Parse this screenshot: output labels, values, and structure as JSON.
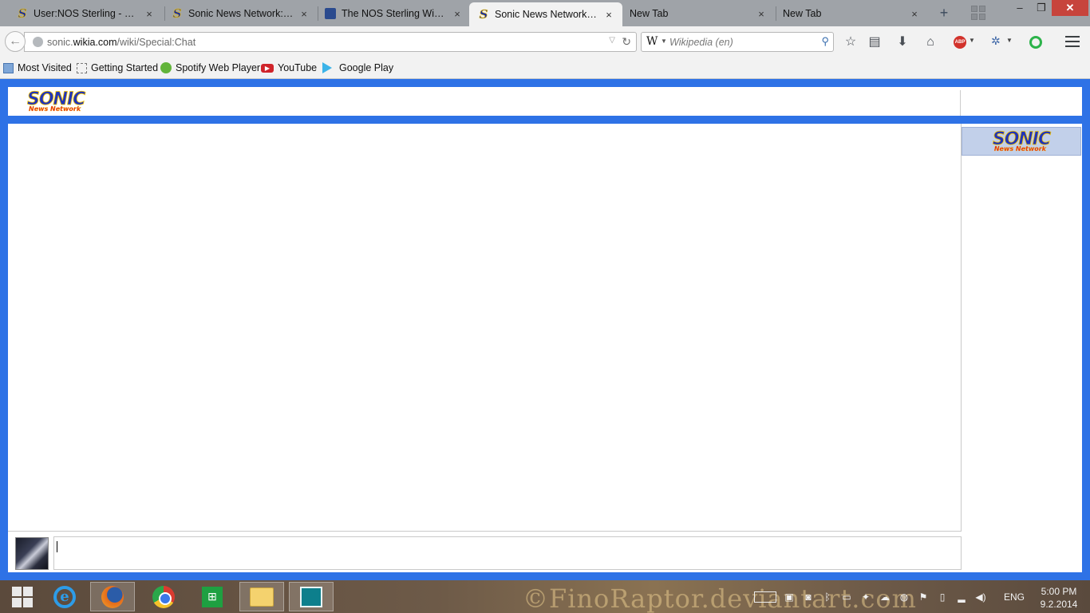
{
  "browser": {
    "tabs": [
      {
        "title": "User:NOS Sterling - Son...",
        "favicon": "sonic-s-icon",
        "active": false
      },
      {
        "title": "Sonic News Network:Al...",
        "favicon": "sonic-s-icon",
        "active": false
      },
      {
        "title": "The NOS Sterling Wiki: ...",
        "favicon": "wikia-icon",
        "active": false
      },
      {
        "title": "Sonic News Network: ...",
        "favicon": "sonic-s-icon",
        "active": true
      },
      {
        "title": "New Tab",
        "favicon": "",
        "active": false
      },
      {
        "title": "New Tab",
        "favicon": "",
        "active": false
      }
    ],
    "close_glyph": "×",
    "new_tab_glyph": "+",
    "window_controls": {
      "minimize": "–",
      "restore": "❐",
      "close": "✕"
    },
    "url": {
      "domain_pre": "sonic.",
      "domain_main": "wikia.com",
      "path": "/wiki/Special:Chat"
    },
    "search": {
      "engine_glyph": "W",
      "placeholder": "Wikipedia (en)"
    },
    "bookmarks": [
      {
        "label": "Most Visited",
        "icon": "most-visited-icon"
      },
      {
        "label": "Getting Started",
        "icon": "getting-started-icon"
      },
      {
        "label": "Spotify Web Player",
        "icon": "spotify-icon"
      },
      {
        "label": "YouTube",
        "icon": "youtube-icon"
      },
      {
        "label": "Google Play",
        "icon": "google-play-icon"
      }
    ],
    "addons": {
      "abp_label": "ABP"
    }
  },
  "chat": {
    "logo": {
      "line1": "SONIC",
      "line2": "News Network"
    },
    "sidebar_room_logo": {
      "line1": "SONIC",
      "line2": "News Network"
    },
    "message_input_value": ""
  },
  "taskbar": {
    "apps": [
      "start",
      "internet-explorer",
      "firefox",
      "chrome",
      "store",
      "file-explorer",
      "photos"
    ],
    "watermark": "©FinoRaptor.deviantart.com",
    "language": "ENG",
    "time": "5:00 PM",
    "date": "9.2.2014"
  },
  "colors": {
    "page_blue": "#2e72e6",
    "tab_strip": "#9fa3a8",
    "chrome": "#f2f2f2",
    "sonic_blue": "#2034b8",
    "sonic_red": "#e3201b",
    "sonic_gold": "#f5c400"
  }
}
